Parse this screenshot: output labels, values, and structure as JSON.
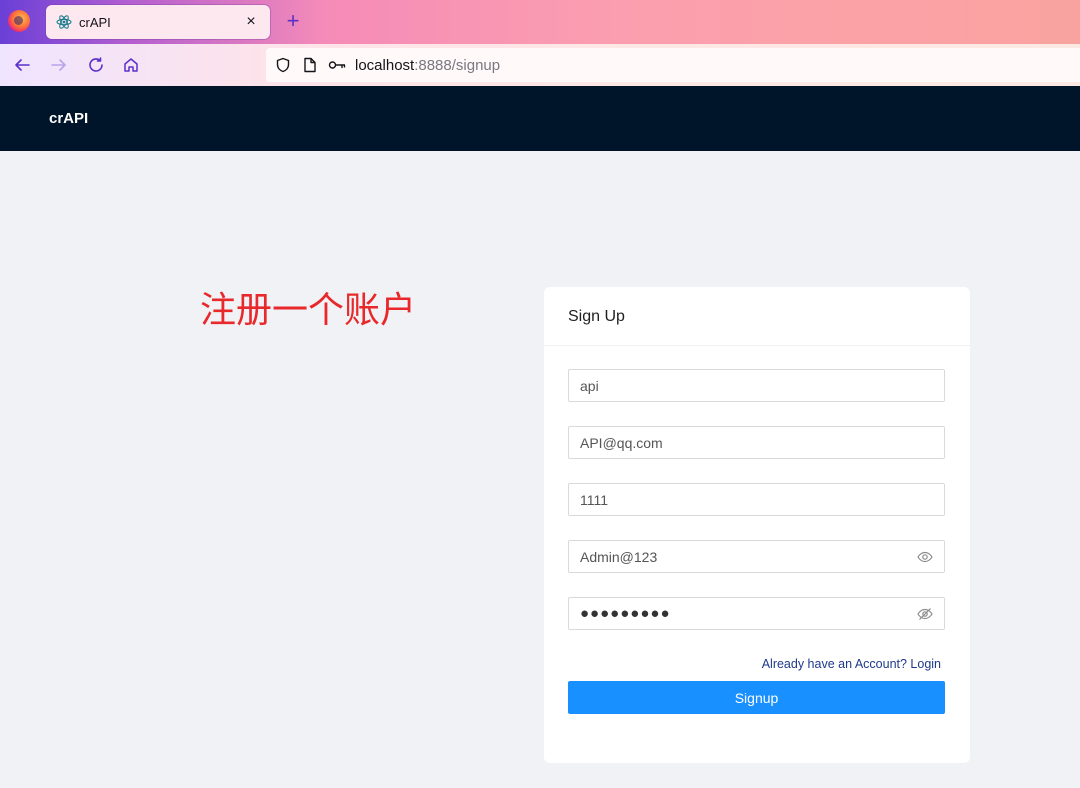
{
  "browser": {
    "tab_title": "crAPI",
    "close_glyph": "×",
    "newtab_glyph": "+",
    "url_host": "localhost",
    "url_rest": ":8888/signup"
  },
  "app": {
    "brand": "crAPI"
  },
  "annotation": {
    "text": "注册一个账户"
  },
  "signup": {
    "title": "Sign Up",
    "name_value": "api",
    "email_value": "API@qq.com",
    "phone_value": "1111",
    "password_value": "Admin@123",
    "confirm_password_masked": "●●●●●●●●●",
    "login_link": "Already have an Account? Login",
    "submit_label": "Signup"
  },
  "colors": {
    "header_bg": "#001529",
    "page_bg": "#f0f2f5",
    "primary": "#1890ff",
    "annotation": "#e8282b"
  },
  "icons": [
    "firefox-icon",
    "react-icon",
    "close-icon",
    "plus-icon",
    "back-arrow-icon",
    "forward-arrow-icon",
    "reload-icon",
    "home-icon",
    "shield-icon",
    "page-icon",
    "key-icon",
    "eye-icon",
    "eye-slash-icon"
  ]
}
